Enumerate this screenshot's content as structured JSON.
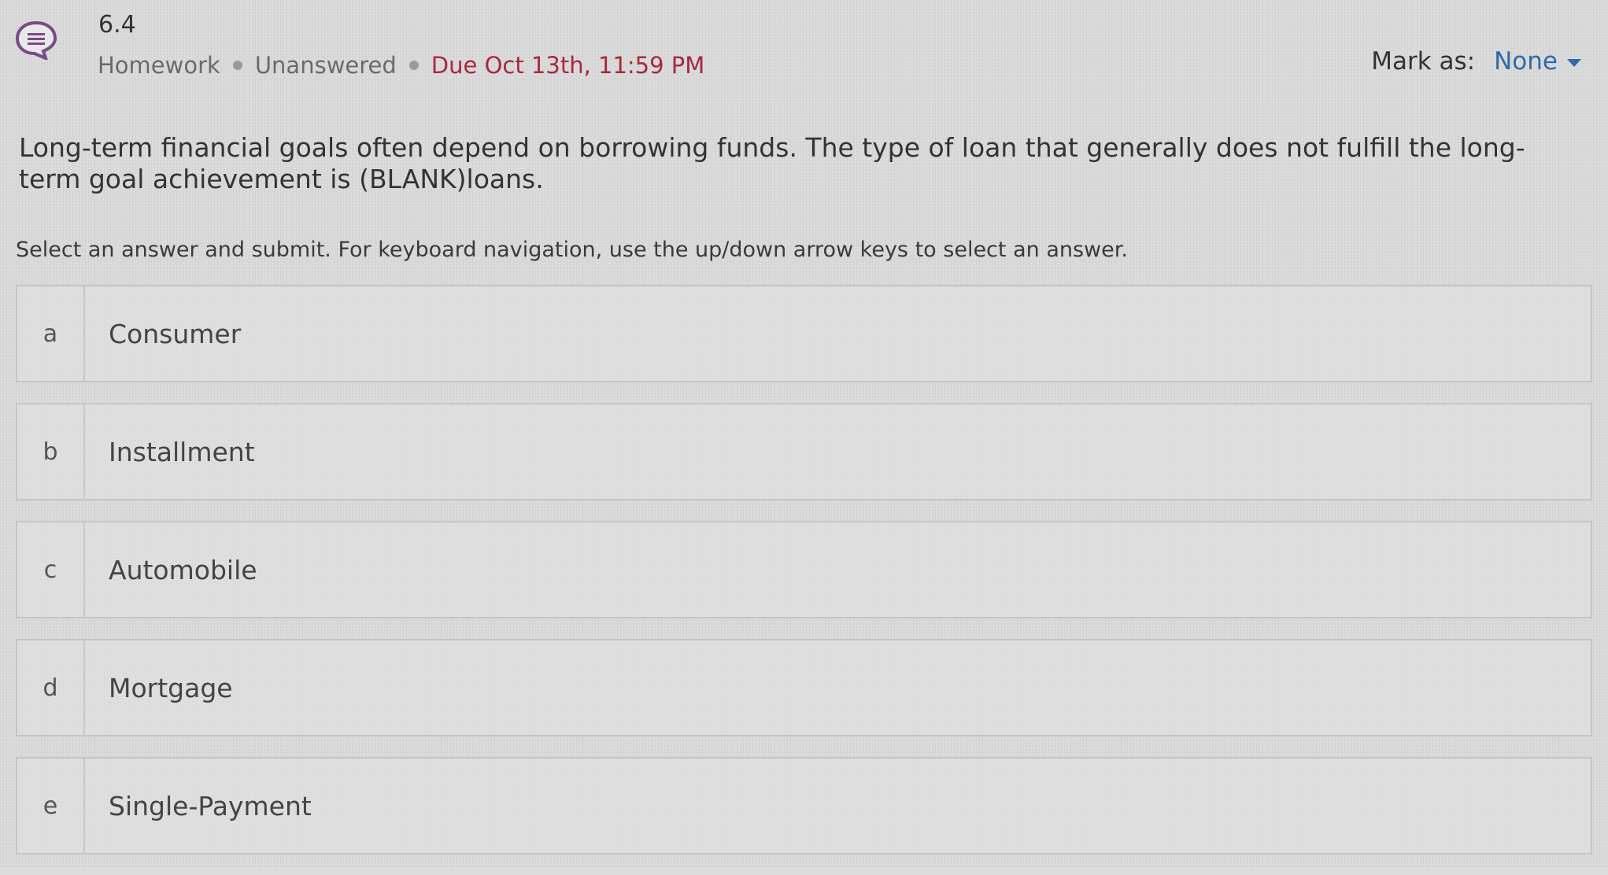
{
  "header": {
    "question_number": "6.4",
    "type": "Homework",
    "status": "Unanswered",
    "due": "Due Oct 13th, 11:59 PM",
    "mark_as_label": "Mark as:",
    "mark_as_value": "None"
  },
  "question": {
    "text": "Long-term financial goals often depend on borrowing funds. The type of loan that generally does not fulfill the long-term goal achievement is (BLANK)loans.",
    "instructions": "Select an answer and submit. For keyboard navigation, use the up/down arrow keys to select an answer."
  },
  "answers": [
    {
      "letter": "a",
      "text": "Consumer"
    },
    {
      "letter": "b",
      "text": "Installment"
    },
    {
      "letter": "c",
      "text": "Automobile"
    },
    {
      "letter": "d",
      "text": "Mortgage"
    },
    {
      "letter": "e",
      "text": "Single-Payment"
    }
  ],
  "colors": {
    "accent_blue": "#2d6aa8",
    "due_red": "#a8283b",
    "icon_purple": "#7a4a86"
  }
}
